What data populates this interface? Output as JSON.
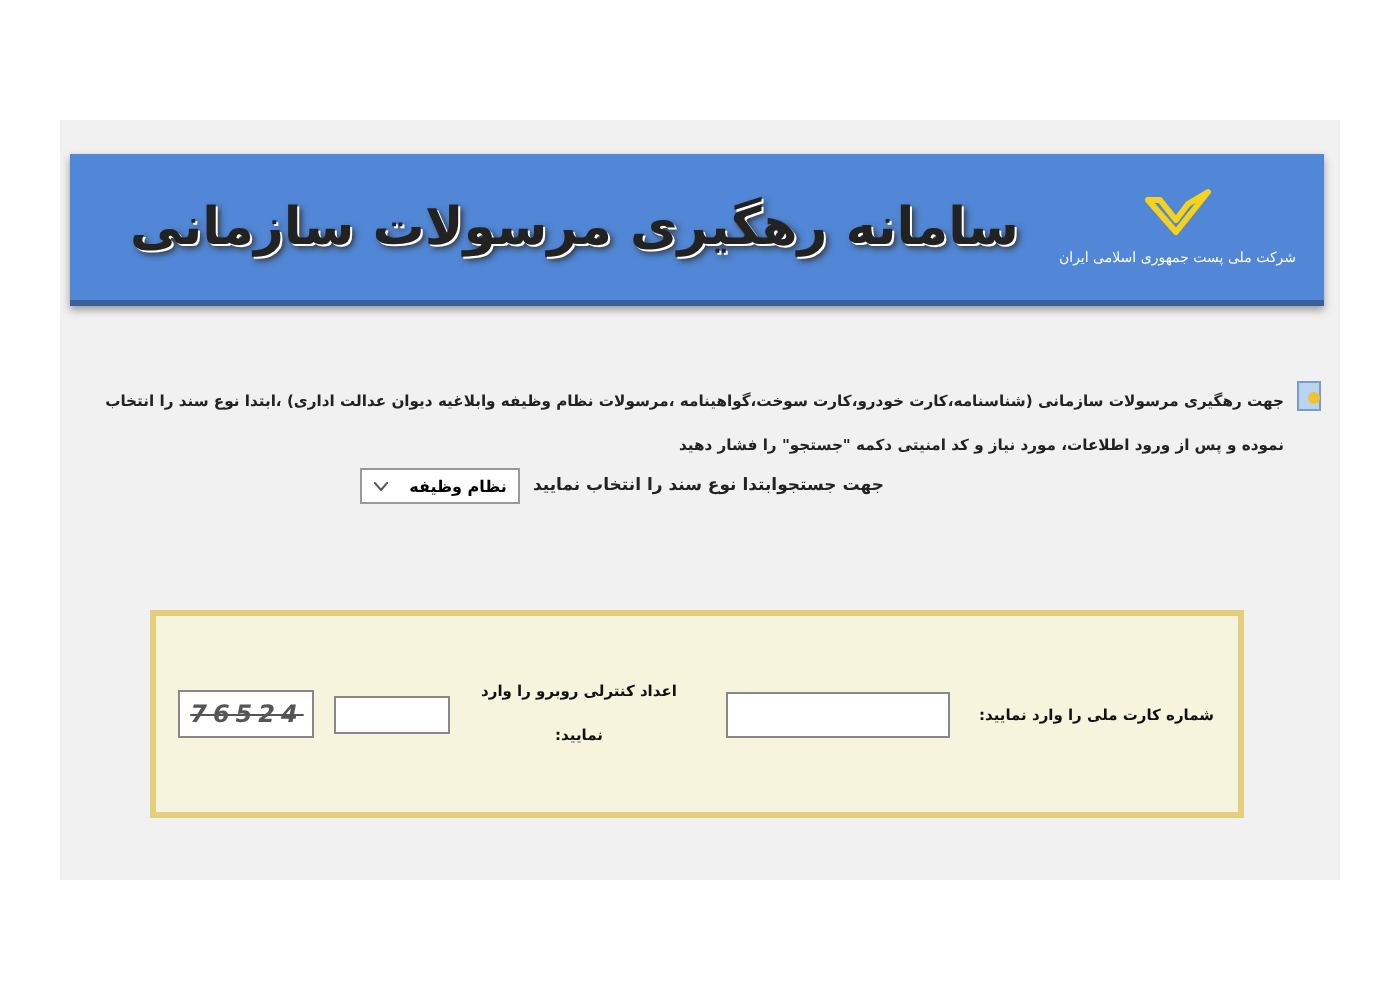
{
  "header": {
    "title": "سامانه رهگیری مرسولات سازمانی",
    "subtitle": "شرکت ملی پست جمهوری اسلامی ایران"
  },
  "intro": "جهت رهگیری مرسولات سازمانی (شناسنامه،کارت خودرو،کارت سوخت،گواهینامه ،مرسولات نظام وظیفه  وابلاغیه دیوان عدالت اداری) ،ابتدا  نوع سند را انتخاب نموده و پس از ورود اطلاعات، مورد نیاز و کد امنیتی دکمه \"جستجو\" را فشار دهید",
  "doc_type": {
    "label": "جهت جستجوابتدا نوع سند را انتخاب نمایید",
    "value": "نظام وظیفه"
  },
  "form": {
    "national_id_label": "شماره کارت ملی را وارد نمایید:",
    "captcha_label": "اعداد کنترلی روبرو را وارد نمایید:",
    "captcha": "76524"
  }
}
